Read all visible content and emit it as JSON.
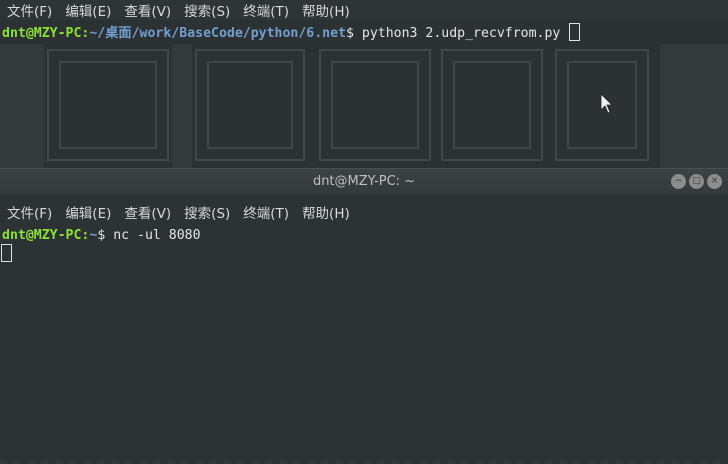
{
  "menu_items": [
    "文件(F)",
    "编辑(E)",
    "查看(V)",
    "搜索(S)",
    "终端(T)",
    "帮助(H)"
  ],
  "top_terminal": {
    "prompt_user": "dnt@MZY-PC",
    "prompt_colon": ":",
    "prompt_path": "~/桌面/work/BaseCode/python/6.net",
    "prompt_symbol": "$",
    "command": " python3 2.udp_recvfrom.py "
  },
  "front_terminal": {
    "title": "dnt@MZY-PC: ~",
    "window_buttons": [
      "−",
      "□",
      "×"
    ],
    "prompt_user": "dnt@MZY-PC",
    "prompt_colon": ":",
    "prompt_path": "~",
    "prompt_symbol": "$",
    "command": " nc -ul 8080"
  },
  "colors": {
    "terminal_bg": "#2d3234",
    "user_green": "#8ae234",
    "path_blue": "#729fcf",
    "text": "#e6e6e6"
  },
  "icons": [
    "minimize-icon",
    "maximize-icon",
    "close-icon",
    "mouse-pointer-icon"
  ]
}
